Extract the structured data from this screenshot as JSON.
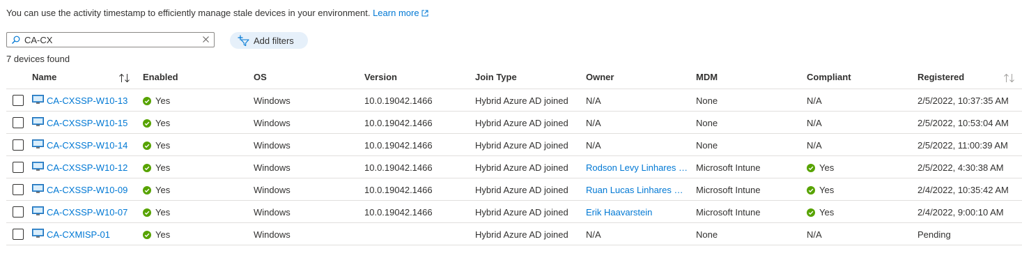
{
  "info": {
    "text": "You can use the activity timestamp to efficiently manage stale devices in your environment.",
    "learn_more": "Learn more"
  },
  "search": {
    "value": "CA-CX"
  },
  "filters": {
    "add_label": "Add filters"
  },
  "result_count": "7 devices found",
  "columns": {
    "name": "Name",
    "enabled": "Enabled",
    "os": "OS",
    "version": "Version",
    "join_type": "Join Type",
    "owner": "Owner",
    "mdm": "MDM",
    "compliant": "Compliant",
    "registered": "Registered"
  },
  "devices": [
    {
      "name": "CA-CXSSP-W10-13",
      "enabled": "Yes",
      "os": "Windows",
      "version": "10.0.19042.1466",
      "join_type": "Hybrid Azure AD joined",
      "owner": "N/A",
      "mdm": "None",
      "compliant": "N/A",
      "registered": "2/5/2022, 10:37:35 AM"
    },
    {
      "name": "CA-CXSSP-W10-15",
      "enabled": "Yes",
      "os": "Windows",
      "version": "10.0.19042.1466",
      "join_type": "Hybrid Azure AD joined",
      "owner": "N/A",
      "mdm": "None",
      "compliant": "N/A",
      "registered": "2/5/2022, 10:53:04 AM"
    },
    {
      "name": "CA-CXSSP-W10-14",
      "enabled": "Yes",
      "os": "Windows",
      "version": "10.0.19042.1466",
      "join_type": "Hybrid Azure AD joined",
      "owner": "N/A",
      "mdm": "None",
      "compliant": "N/A",
      "registered": "2/5/2022, 11:00:39 AM"
    },
    {
      "name": "CA-CXSSP-W10-12",
      "enabled": "Yes",
      "os": "Windows",
      "version": "10.0.19042.1466",
      "join_type": "Hybrid Azure AD joined",
      "owner": "Rodson Levy Linhares D...",
      "mdm": "Microsoft Intune",
      "compliant": "Yes",
      "registered": "2/5/2022, 4:30:38 AM"
    },
    {
      "name": "CA-CXSSP-W10-09",
      "enabled": "Yes",
      "os": "Windows",
      "version": "10.0.19042.1466",
      "join_type": "Hybrid Azure AD joined",
      "owner": "Ruan Lucas Linhares No...",
      "mdm": "Microsoft Intune",
      "compliant": "Yes",
      "registered": "2/4/2022, 10:35:42 AM"
    },
    {
      "name": "CA-CXSSP-W10-07",
      "enabled": "Yes",
      "os": "Windows",
      "version": "10.0.19042.1466",
      "join_type": "Hybrid Azure AD joined",
      "owner": "Erik Haavarstein",
      "mdm": "Microsoft Intune",
      "compliant": "Yes",
      "registered": "2/4/2022, 9:00:10 AM"
    },
    {
      "name": "CA-CXMISP-01",
      "enabled": "Yes",
      "os": "Windows",
      "version": "",
      "join_type": "Hybrid Azure AD joined",
      "owner": "N/A",
      "mdm": "None",
      "compliant": "N/A",
      "registered": "Pending"
    }
  ],
  "colors": {
    "link": "#0078d4",
    "success": "#57a300",
    "chip": "#e6f0fa"
  }
}
